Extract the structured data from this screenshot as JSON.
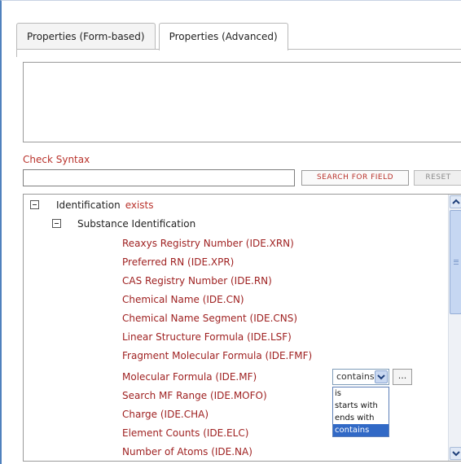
{
  "tabs": [
    {
      "label": "Properties (Form-based)",
      "active": false
    },
    {
      "label": "Properties (Advanced)",
      "active": true
    }
  ],
  "query": {
    "value": ""
  },
  "check_syntax_label": "Check Syntax",
  "search": {
    "value": "",
    "search_label": "SEARCH FOR FIELD",
    "reset_label": "RESET"
  },
  "tree": {
    "root": {
      "label": "Identification",
      "badge": "exists"
    },
    "group": {
      "label": "Substance Identification"
    },
    "fields": [
      "Reaxys Registry Number (IDE.XRN)",
      "Preferred RN (IDE.XPR)",
      "CAS Registry Number (IDE.RN)",
      "Chemical Name (IDE.CN)",
      "Chemical Name Segment (IDE.CNS)",
      "Linear Structure Formula (IDE.LSF)",
      "Fragment Molecular Formula (IDE.FMF)",
      "Molecular Formula (IDE.MF)",
      "Search MF Range (IDE.MOFO)",
      "Charge (IDE.CHA)",
      "Element Counts (IDE.ELC)",
      "Number of Atoms (IDE.NA)"
    ]
  },
  "operator": {
    "selected": "contains",
    "more_label": "...",
    "options": [
      "is",
      "starts with",
      "ends with",
      "contains"
    ],
    "highlighted": "contains"
  },
  "colors": {
    "accent": "#4f81bd",
    "field_text": "#9e1f1f",
    "link": "#b9332c",
    "highlight": "#3169c6"
  }
}
